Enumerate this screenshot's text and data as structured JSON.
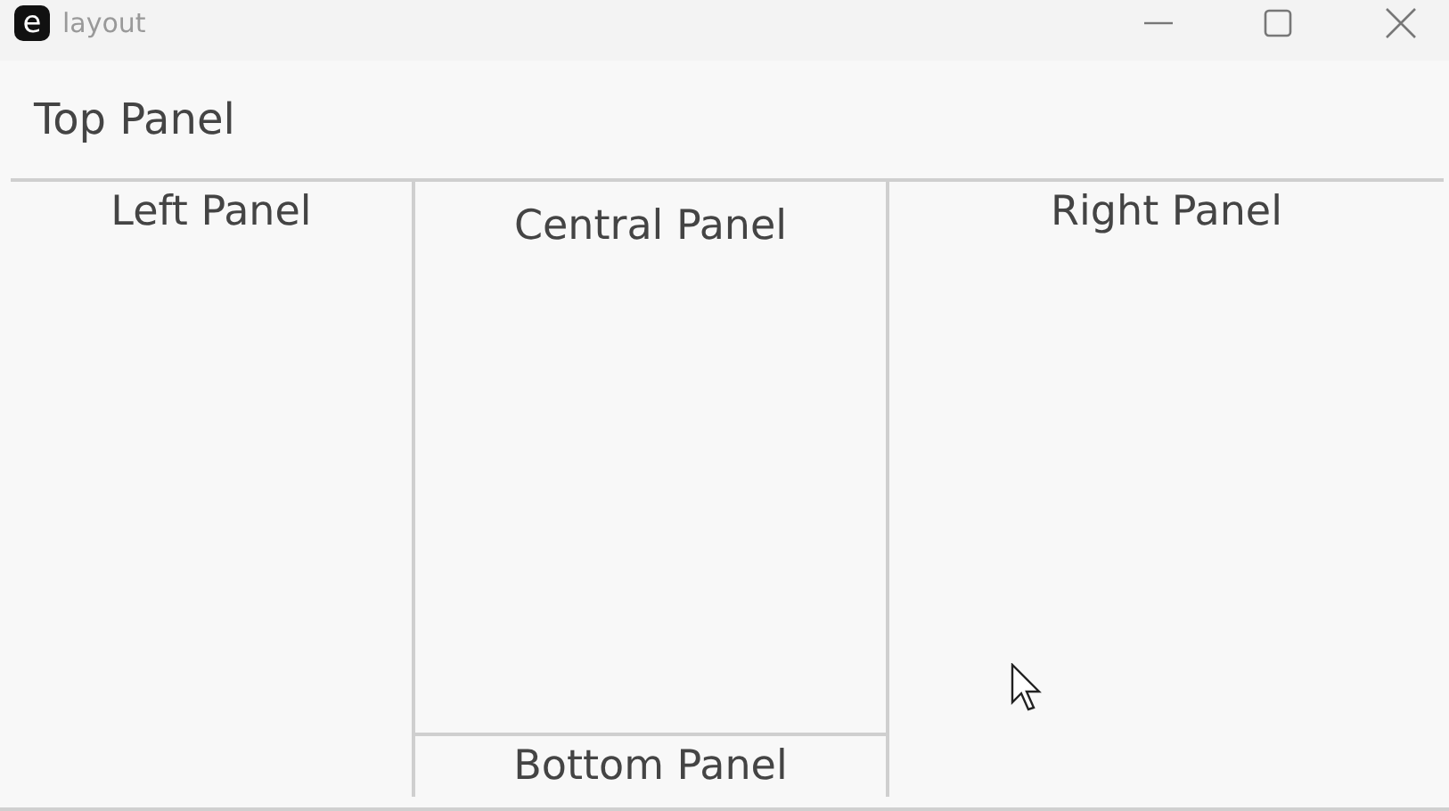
{
  "window": {
    "app_icon": "e",
    "title": "layout"
  },
  "top_panel": {
    "label": "Top Panel"
  },
  "left_panel": {
    "label": "Left Panel"
  },
  "central_panel": {
    "label": "Central Panel"
  },
  "bottom_panel": {
    "label": "Bottom Panel"
  },
  "right_panel": {
    "label": "Right Panel"
  }
}
